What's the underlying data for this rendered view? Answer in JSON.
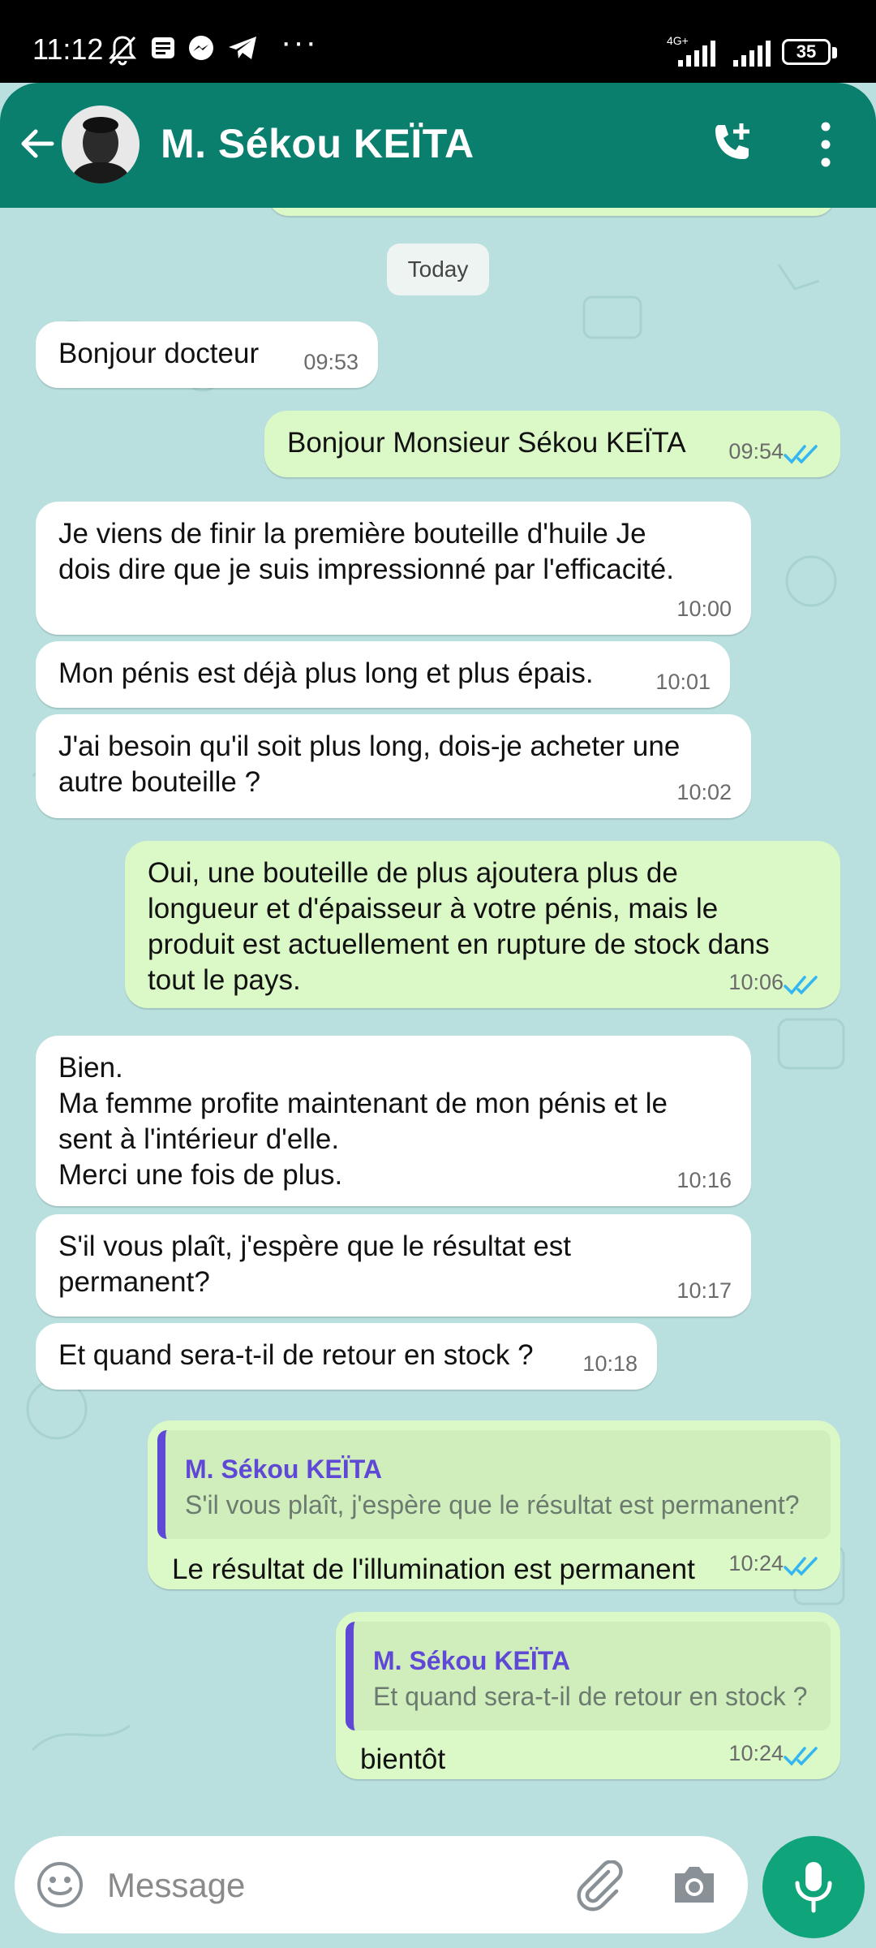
{
  "status_bar": {
    "time": "11:12",
    "network": "4G+",
    "battery": "35"
  },
  "header": {
    "contact_name": "M.  Sékou KEÏTA"
  },
  "chat": {
    "date_chip": "Today",
    "messages": [
      {
        "dir": "in",
        "lines": [
          "Bonjour docteur"
        ],
        "time": "09:53"
      },
      {
        "dir": "out",
        "lines": [
          "Bonjour Monsieur Sékou KEÏTA"
        ],
        "time": "09:54"
      },
      {
        "dir": "in",
        "lines": [
          "Je viens de finir la première bouteille d'huile Je",
          "dois dire que je suis impressionné par l'efficacité."
        ],
        "time": "10:00"
      },
      {
        "dir": "in",
        "lines": [
          "Mon pénis est déjà plus long et plus épais."
        ],
        "time": "10:01"
      },
      {
        "dir": "in",
        "lines": [
          "J'ai besoin qu'il soit plus long, dois-je acheter une",
          "autre bouteille ?"
        ],
        "time": "10:02"
      },
      {
        "dir": "out",
        "lines": [
          "Oui, une bouteille de plus ajoutera plus de",
          "longueur et d'épaisseur à votre pénis, mais le",
          "produit est actuellement en rupture de stock dans",
          "tout le pays."
        ],
        "time": "10:06"
      },
      {
        "dir": "in",
        "lines": [
          "Bien.",
          "Ma femme profite maintenant de mon pénis et le",
          "sent à l'intérieur d'elle.",
          "Merci une fois de plus."
        ],
        "time": "10:16"
      },
      {
        "dir": "in",
        "lines": [
          "S'il vous plaît, j'espère que le résultat est",
          "permanent?"
        ],
        "time": "10:17"
      },
      {
        "dir": "in",
        "lines": [
          "Et quand sera-t-il de retour en stock ?"
        ],
        "time": "10:18"
      },
      {
        "dir": "out",
        "quote": {
          "name": "M.  Sékou KEÏTA",
          "text": "S'il vous plaît, j'espère que le résultat est permanent?"
        },
        "lines": [
          "Le résultat de l'illumination est permanent"
        ],
        "time": "10:24"
      },
      {
        "dir": "out",
        "quote": {
          "name": "M.  Sékou KEÏTA",
          "text": "Et quand sera-t-il de retour en stock ?"
        },
        "lines": [
          "bientôt"
        ],
        "time": "10:24"
      }
    ]
  },
  "composer": {
    "placeholder": "Message"
  },
  "colors": {
    "header": "#0a7f6d",
    "outgoing": "#dbf8c7",
    "incoming": "#ffffff",
    "read_ticks": "#34b7f1",
    "mic": "#0fa47a",
    "quote_accent": "#5f48d6"
  },
  "icons": [
    "back-arrow-icon",
    "add-call-icon",
    "more-vert-icon",
    "emoji-icon",
    "attach-icon",
    "camera-icon",
    "mic-icon",
    "read-ticks-icon"
  ]
}
